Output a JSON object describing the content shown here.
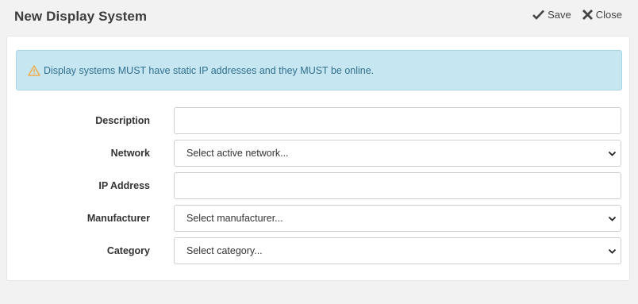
{
  "header": {
    "title": "New Display System",
    "save_label": "Save",
    "close_label": "Close"
  },
  "alert": {
    "text": "Display systems MUST have static IP addresses and they MUST be online."
  },
  "form": {
    "description_label": "Description",
    "description_value": "",
    "network_label": "Network",
    "network_placeholder": "Select active network...",
    "ip_label": "IP Address",
    "ip_value": "",
    "manufacturer_label": "Manufacturer",
    "manufacturer_placeholder": "Select manufacturer...",
    "category_label": "Category",
    "category_placeholder": "Select category..."
  },
  "colors": {
    "alert_bg": "#c6e6f1",
    "alert_text": "#31708f",
    "warning_icon": "#f0ad4e"
  },
  "icons": [
    "check-icon",
    "close-icon",
    "warning-icon",
    "chevron-down-icon"
  ]
}
